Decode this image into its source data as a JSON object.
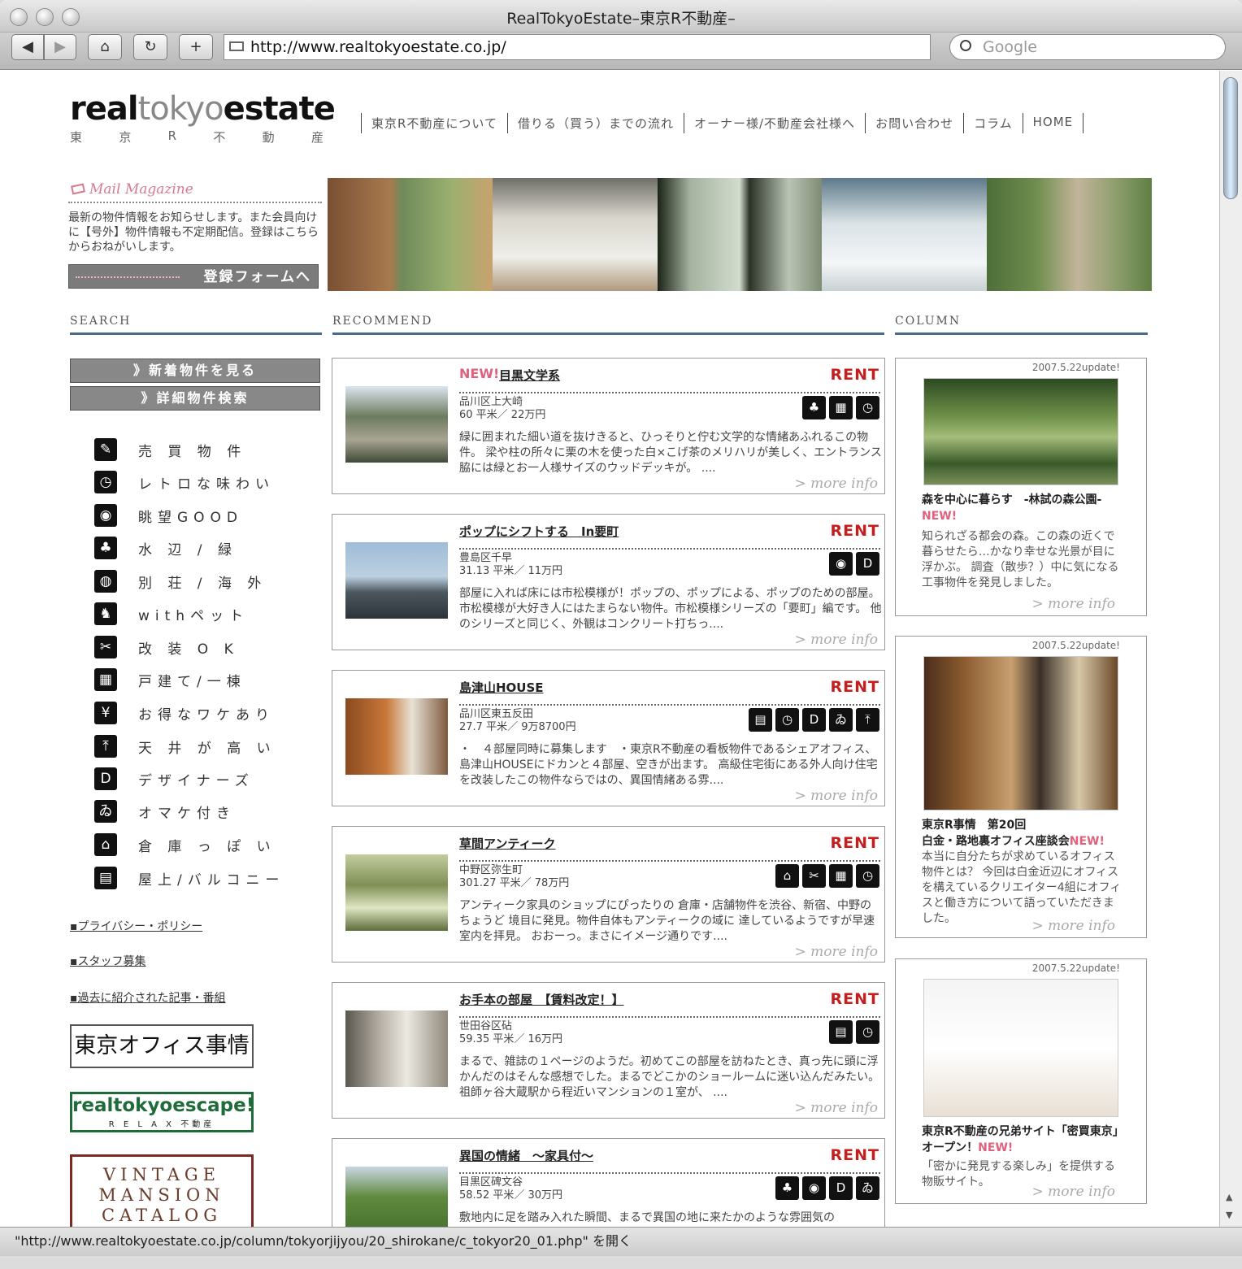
{
  "browser": {
    "window_title": "RealTokyoEstate–東京R不動産–",
    "back": "◀",
    "forward": "▶",
    "home": "⌂",
    "reload": "↻",
    "add": "+",
    "url": "http://www.realtokyoestate.co.jp/",
    "search_placeholder": "Google",
    "status_text": "\"http://www.realtokyoestate.co.jp/column/tokyorjijyou/20_shirokane/c_tokyor20_01.php\" を開く"
  },
  "site": {
    "logo_real": "real",
    "logo_tokyo": "tokyo",
    "logo_estate": "estate",
    "logo_sub": [
      "東",
      "京",
      "R",
      "不",
      "動",
      "産"
    ],
    "nav": [
      "東京R不動産について",
      "借りる（買う）までの流れ",
      "オーナー様/不動産会社様へ",
      "お問い合わせ",
      "コラム",
      "HOME"
    ]
  },
  "mail_magazine": {
    "title": "Mail Magazine",
    "text": "最新の物件情報をお知らせします。また会員向けに【号外】物件情報も不定期配信。登録はこちらからおねがいします。",
    "button": "登録フォームへ"
  },
  "sections": {
    "search": "SEARCH",
    "recommend": "RECOMMEND",
    "column": "COLUMN"
  },
  "search": {
    "buttons": [
      "》新着物件を見る",
      "》詳細物件検索"
    ],
    "categories": [
      {
        "icon": "buy-icon",
        "glyph": "✎",
        "label": "売 買 物 件"
      },
      {
        "icon": "retro-clock-icon",
        "glyph": "◷",
        "label": "レトロな味わい"
      },
      {
        "icon": "view-eye-icon",
        "glyph": "◉",
        "label": "眺望GOOD"
      },
      {
        "icon": "waterside-icon",
        "glyph": "♣",
        "label": "水 辺 / 緑"
      },
      {
        "icon": "globe-icon",
        "glyph": "◍",
        "label": "別 荘 / 海 外"
      },
      {
        "icon": "pet-icon",
        "glyph": "♞",
        "label": "withペット"
      },
      {
        "icon": "renovation-icon",
        "glyph": "✂",
        "label": "改 装 O K"
      },
      {
        "icon": "house-icon",
        "glyph": "▦",
        "label": "戸建て/一棟"
      },
      {
        "icon": "yen-icon",
        "glyph": "¥",
        "label": "お得なワケあり"
      },
      {
        "icon": "ceiling-icon",
        "glyph": "⤒",
        "label": "天 井 が 高 い"
      },
      {
        "icon": "designer-icon",
        "glyph": "D",
        "label": "デザイナーズ"
      },
      {
        "icon": "bonus-icon",
        "glyph": "ゐ",
        "label": "オマケ付き"
      },
      {
        "icon": "warehouse-icon",
        "glyph": "⌂",
        "label": "倉 庫 っ ぽ い"
      },
      {
        "icon": "rooftop-icon",
        "glyph": "▤",
        "label": "屋上/バルコニー"
      }
    ],
    "links": [
      "▪プライバシー・ポリシー",
      "▪スタッフ募集",
      "▪過去に紹介された記事・番組"
    ],
    "banner_office": "東京オフィス事情",
    "banner_escape": "realtokyoescape!",
    "banner_escape_sub": "R E L A X 不動産",
    "banner_vintage": [
      "VINTAGE",
      "MANSION",
      "CATALOG"
    ]
  },
  "recommend": [
    {
      "new": "NEW!",
      "title": "目黒文学系",
      "rent": "RENT",
      "location": "品川区上大崎",
      "size": "60 平米／ 22万円",
      "icons": [
        "♣",
        "▦",
        "◷"
      ],
      "desc": "緑に囲まれた細い道を抜けきると、ひっそりと佇む文学的な情緒あふれるこの物件。 梁や柱の所々に栗の木を使った白×こげ茶のメリハリが美しく、エントランス脇には緑とお一人様サイズのウッドデッキが。 ....",
      "more": "> more info"
    },
    {
      "new": "",
      "title": "ポップにシフトする　In要町",
      "rent": "RENT",
      "location": "豊島区千早",
      "size": "31.13 平米／ 11万円",
      "icons": [
        "◉",
        "D"
      ],
      "desc": "部屋に入れば床には市松模様が！ポップの、ポップによる、ポップのための部屋。市松模様が大好き人にはたまらない物件。市松模様シリーズの「要町」編です。 他のシリーズと同じく、外観はコンクリート打ちっ....",
      "more": "> more info"
    },
    {
      "new": "",
      "title": "島津山HOUSE",
      "rent": "RENT",
      "location": "品川区東五反田",
      "size": "27.7 平米／ 9万8700円",
      "icons": [
        "▤",
        "◷",
        "D",
        "ゐ",
        "⤒"
      ],
      "desc": "・　４部屋同時に募集します　・東京R不動産の看板物件であるシェアオフィス、島津山HOUSEにドカンと４部屋、空きが出ます。 高級住宅街にある外人向け住宅を改装したこの物件ならではの、異国情緒ある雰....",
      "more": "> more info"
    },
    {
      "new": "",
      "title": "草間アンティーク",
      "rent": "RENT",
      "location": "中野区弥生町",
      "size": "301.27 平米／ 78万円",
      "icons": [
        "⌂",
        "✂",
        "▦",
        "◷"
      ],
      "desc": "アンティーク家具のショップにぴったりの 倉庫・店舗物件を渋谷、新宿、中野のちょうど 境目に発見。物件自体もアンティークの域に 達しているようですが早速室内を拝見。 おおーっ。まさにイメージ通りです....",
      "more": "> more info"
    },
    {
      "new": "",
      "title": "お手本の部屋　【賃料改定！】",
      "rent": "RENT",
      "location": "世田谷区砧",
      "size": "59.35 平米／ 16万円",
      "icons": [
        "▤",
        "◷"
      ],
      "desc": "まるで、雑誌の１ページのようだ。初めてこの部屋を訪ねたとき、真っ先に頭に浮かんだのはそんな感想でした。まるでどこかのショールームに迷い込んだみたい。 祖師ヶ谷大蔵駅から程近いマンションの１室が、 ....",
      "more": "> more info"
    },
    {
      "new": "",
      "title": "異国の情緒　～家具付～",
      "rent": "RENT",
      "location": "目黒区碑文谷",
      "size": "58.52 平米／ 30万円",
      "icons": [
        "♣",
        "◉",
        "D",
        "ゐ"
      ],
      "desc": "敷地内に足を踏み入れた瞬間、まるで異国の地に来たかのような雰囲気の",
      "more": "> more info"
    }
  ],
  "columns": [
    {
      "update": "2007.5.22update!",
      "title": "森を中心に暮らす　-林試の森公園-",
      "new": "NEW!",
      "desc": "知られざる都会の森。この森の近くで暮らせたら…かなり幸せな光景が目に浮かぶ。 調査（散歩？）中に気になる工事物件を発見しました。",
      "more": "> more info"
    },
    {
      "update": "2007.5.22update!",
      "title": "東京R事情　第20回\n白金・路地裏オフィス座談会",
      "new": "NEW!",
      "desc": "本当に自分たちが求めているオフィス物件とは？ 今回は白金近辺にオフィスを構えているクリエイター4組にオフィスと働き方について語っていただきました。",
      "more": "> more info"
    },
    {
      "update": "2007.5.22update!",
      "title": "東京R不動産の兄弟サイト「密買東京」オープン！",
      "new": "NEW!",
      "desc": "「密かに発見する楽しみ」を提供する物販サイト。",
      "more": "> more info"
    }
  ]
}
